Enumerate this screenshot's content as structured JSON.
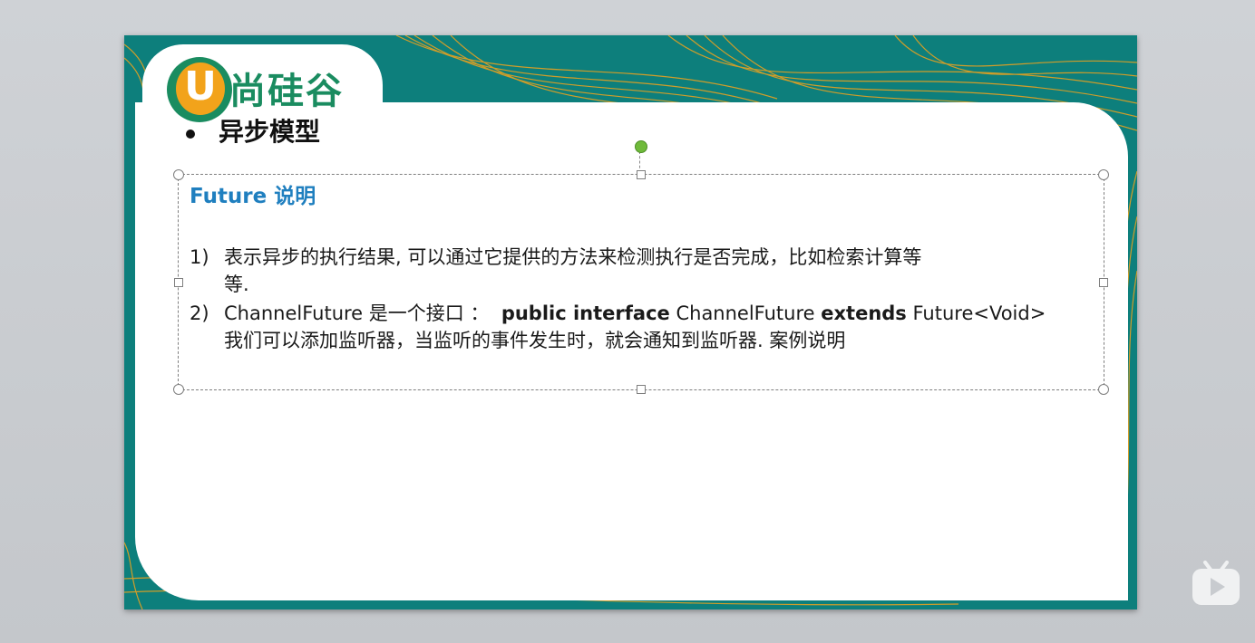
{
  "logo": {
    "letter": "U",
    "text": "尚硅谷"
  },
  "slide": {
    "title": "异步模型",
    "textbox": {
      "heading": "Future 说明",
      "items": [
        {
          "num": "1)",
          "line1": "表示异步的执行结果, 可以通过它提供的方法来检测执行是否完成，比如检索计算等",
          "line2": "等."
        },
        {
          "num": "2)",
          "prefix": "ChannelFuture 是一个接口 ：",
          "kw1": "public interface",
          "mid": "ChannelFuture",
          "kw2": "extends",
          "suffix": "Future<Void>",
          "line2": "我们可以添加监听器，当监听的事件发生时，就会通知到监听器. 案例说明"
        }
      ]
    }
  },
  "colors": {
    "teal": "#0d7f7c",
    "orange": "#f2a31b",
    "logo_green": "#1a8c60",
    "heading_blue": "#1f7fbf",
    "rotate_handle": "#6fba3a"
  },
  "icons": {
    "watermark": "tv-play-icon",
    "rotate": "rotate-handle-icon"
  }
}
